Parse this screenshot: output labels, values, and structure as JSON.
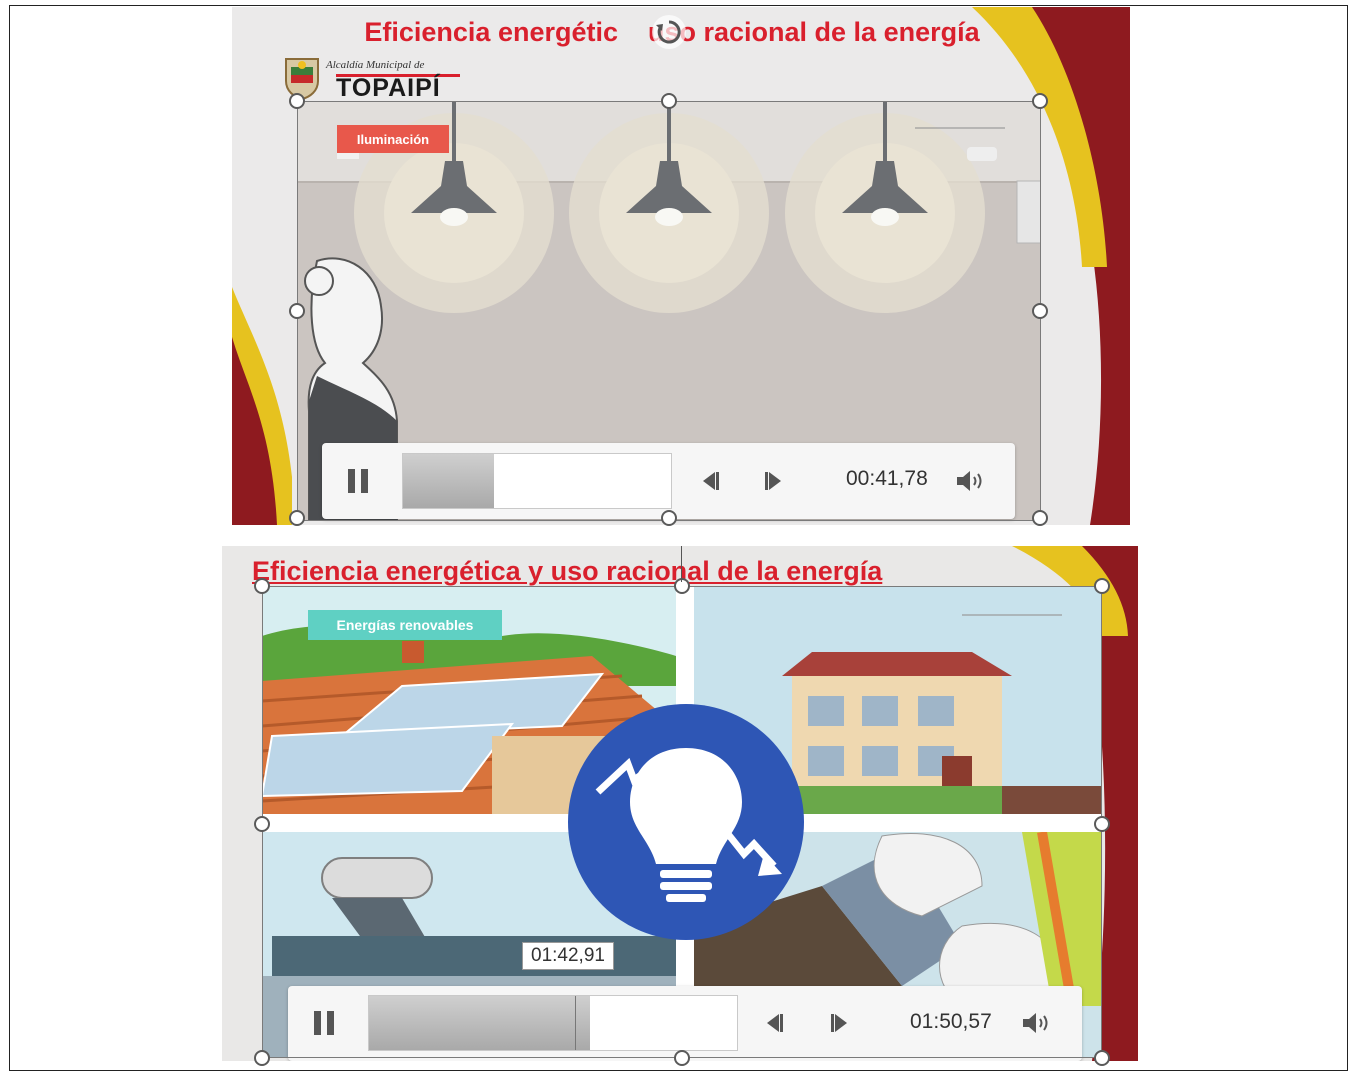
{
  "slide1": {
    "title": "Eficiencia energétic    uso racional de la energía",
    "logo_small": "Alcaldía Municipal de",
    "logo_big": "TOPAIPÍ",
    "badge": "Iluminación",
    "player": {
      "current_time": "00:41,78",
      "progress": 0.34
    }
  },
  "slide2": {
    "title": "Eficiencia energética y uso racional de la energía",
    "badge": "Energías renovables",
    "player": {
      "current_time": "01:50,57",
      "hover_time": "01:42,91",
      "progress": 0.6,
      "hover_position": 0.56
    }
  },
  "icons": [
    "rotate-handle-icon",
    "pause-icon",
    "step-back-icon",
    "step-forward-icon",
    "volume-icon",
    "energy-bulb-icon"
  ],
  "colors": {
    "title_red": "#d9202d",
    "ribbon_yellow": "#e6c21f",
    "ribbon_red": "#8e1a1f",
    "badge_red": "#e8584b",
    "badge_teal": "#5fd0c3",
    "bulb_blue": "#2e56b5"
  }
}
